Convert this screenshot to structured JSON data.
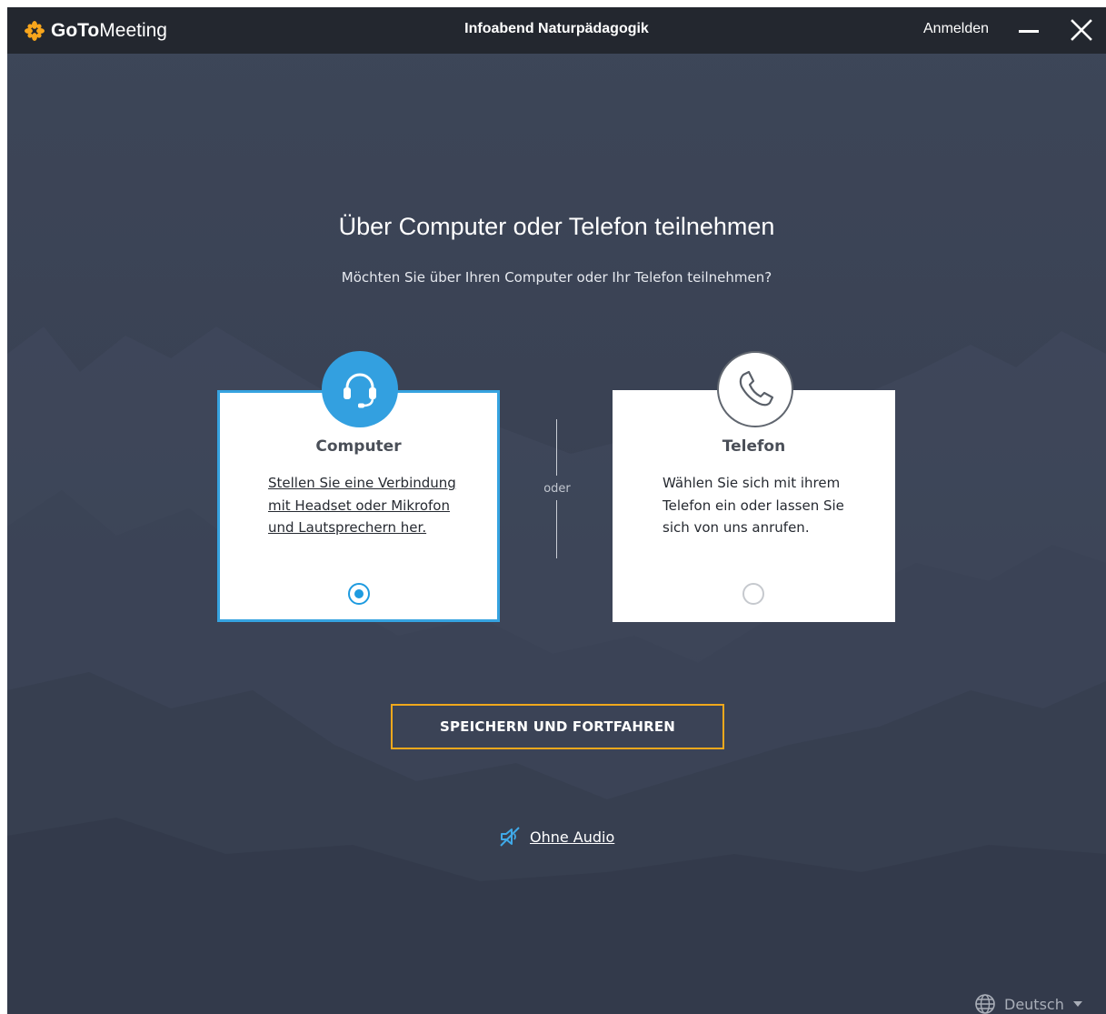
{
  "app": {
    "logo_bold": "GoTo",
    "logo_light": "Meeting",
    "meeting_title": "Infoabend Naturpädagogik",
    "signin_label": "Anmelden"
  },
  "main": {
    "heading": "Über Computer oder Telefon teilnehmen",
    "subheading": "Möchten Sie über Ihren Computer oder Ihr Telefon teilnehmen?",
    "options": [
      {
        "title": "Computer",
        "description": "Stellen Sie eine Verbindung mit Headset oder Mikrofon und Lautsprechern her.",
        "selected": true,
        "icon": "headset-icon"
      },
      {
        "title": "Telefon",
        "description": "Wählen Sie sich mit ihrem Telefon ein oder lassen Sie sich von uns anrufen.",
        "selected": false,
        "icon": "phone-icon"
      }
    ],
    "divider_label": "oder",
    "save_button": "SPEICHERN UND FORTFAHREN",
    "no_audio_label": "Ohne Audio"
  },
  "footer": {
    "language": "Deutsch"
  },
  "colors": {
    "titlebar": "#23272f",
    "background": "#3a4254",
    "accent_blue": "#33a0e0",
    "button_border": "#f0a81c",
    "logo_orange": "#f7a51c"
  }
}
